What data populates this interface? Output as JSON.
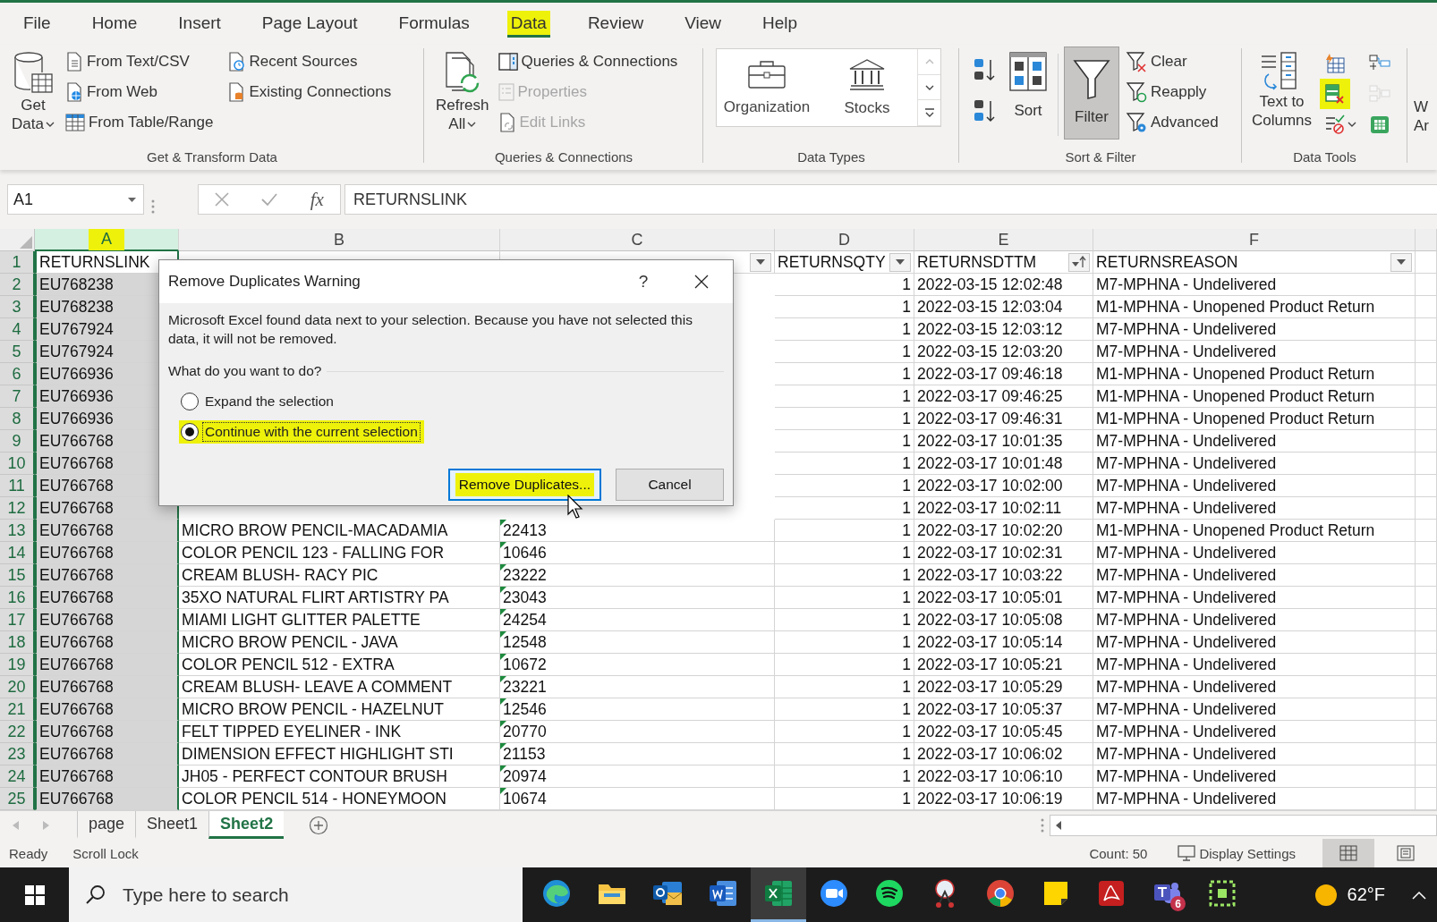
{
  "tabs": [
    {
      "label": "File",
      "selected": false,
      "highlighted": false
    },
    {
      "label": "Home",
      "selected": false,
      "highlighted": false
    },
    {
      "label": "Insert",
      "selected": false,
      "highlighted": false
    },
    {
      "label": "Page Layout",
      "selected": false,
      "highlighted": false
    },
    {
      "label": "Formulas",
      "selected": false,
      "highlighted": false
    },
    {
      "label": "Data",
      "selected": true,
      "highlighted": true
    },
    {
      "label": "Review",
      "selected": false,
      "highlighted": false
    },
    {
      "label": "View",
      "selected": false,
      "highlighted": false
    },
    {
      "label": "Help",
      "selected": false,
      "highlighted": false
    }
  ],
  "ribbon": {
    "get_transform": {
      "title": "Get & Transform Data",
      "get_data": [
        "Get",
        "Data"
      ],
      "items": [
        {
          "label": "From Text/CSV",
          "disabled": false
        },
        {
          "label": "From Web",
          "disabled": false
        },
        {
          "label": "From Table/Range",
          "disabled": false
        },
        {
          "label": "Recent Sources",
          "disabled": false
        },
        {
          "label": "Existing Connections",
          "disabled": false
        }
      ]
    },
    "queries": {
      "title": "Queries & Connections",
      "refresh": [
        "Refresh",
        "All"
      ],
      "items": [
        {
          "label": "Queries & Connections",
          "disabled": false
        },
        {
          "label": "Properties",
          "disabled": true
        },
        {
          "label": "Edit Links",
          "disabled": true
        }
      ]
    },
    "data_types": {
      "title": "Data Types",
      "items": [
        "Organization",
        "Stocks"
      ]
    },
    "sort_filter": {
      "title": "Sort & Filter",
      "sort": "Sort",
      "filter": {
        "label": "Filter",
        "selected": true
      },
      "items": [
        {
          "label": "Clear",
          "disabled": false
        },
        {
          "label": "Reapply",
          "disabled": false
        },
        {
          "label": "Advanced",
          "disabled": false
        }
      ]
    },
    "data_tools": {
      "title": "Data Tools",
      "text_to_columns": [
        "Text to",
        "Columns"
      ],
      "tools": [
        {
          "highlighted": false,
          "disabled": false
        },
        {
          "highlighted": true,
          "disabled": false
        },
        {
          "highlighted": false,
          "disabled": false
        },
        {
          "highlighted": false,
          "disabled": false
        },
        {
          "highlighted": false,
          "disabled": true
        },
        {
          "highlighted": false,
          "disabled": false
        }
      ]
    },
    "what_if": [
      "W",
      "Ar"
    ]
  },
  "formula_bar": {
    "name_box": "A1",
    "fx": "fx",
    "value": "RETURNSLINK"
  },
  "columns": [
    {
      "letter": "A",
      "selected": true,
      "highlighted": true
    },
    {
      "letter": "B",
      "selected": false,
      "highlighted": false
    },
    {
      "letter": "C",
      "selected": false,
      "highlighted": false
    },
    {
      "letter": "D",
      "selected": false,
      "highlighted": false
    },
    {
      "letter": "E",
      "selected": false,
      "highlighted": false
    },
    {
      "letter": "F",
      "selected": false,
      "highlighted": false
    }
  ],
  "header_row": {
    "number": "1",
    "cells": [
      {
        "text": "RETURNSLINK",
        "active": true
      },
      {},
      {
        "filter_button": true
      },
      {
        "text": "RETURNSQTY",
        "filter_button": true
      },
      {
        "text": "RETURNSDTTM",
        "filter_button": true,
        "sorted_ascending": true
      },
      {
        "text": "RETURNSREASON",
        "filter_button": true
      }
    ]
  },
  "rows": [
    {
      "number": "2",
      "link": "EU768238",
      "qty": "1",
      "dttm": "2022-03-15 12:02:48",
      "reason": "M7-MPHNA - Undelivered"
    },
    {
      "number": "3",
      "link": "EU768238",
      "qty": "1",
      "dttm": "2022-03-15 12:03:04",
      "reason": "M1-MPHNA - Unopened Product Return"
    },
    {
      "number": "4",
      "link": "EU767924",
      "qty": "1",
      "dttm": "2022-03-15 12:03:12",
      "reason": "M7-MPHNA - Undelivered"
    },
    {
      "number": "5",
      "link": "EU767924",
      "qty": "1",
      "dttm": "2022-03-15 12:03:20",
      "reason": "M7-MPHNA - Undelivered"
    },
    {
      "number": "6",
      "link": "EU766936",
      "qty": "1",
      "dttm": "2022-03-17 09:46:18",
      "reason": "M1-MPHNA - Unopened Product Return"
    },
    {
      "number": "7",
      "link": "EU766936",
      "qty": "1",
      "dttm": "2022-03-17 09:46:25",
      "reason": "M1-MPHNA - Unopened Product Return"
    },
    {
      "number": "8",
      "link": "EU766936",
      "qty": "1",
      "dttm": "2022-03-17 09:46:31",
      "reason": "M1-MPHNA - Unopened Product Return"
    },
    {
      "number": "9",
      "link": "EU766768",
      "qty": "1",
      "dttm": "2022-03-17 10:01:35",
      "reason": "M7-MPHNA - Undelivered"
    },
    {
      "number": "10",
      "link": "EU766768",
      "qty": "1",
      "dttm": "2022-03-17 10:01:48",
      "reason": "M7-MPHNA - Undelivered"
    },
    {
      "number": "11",
      "link": "EU766768",
      "qty": "1",
      "dttm": "2022-03-17 10:02:00",
      "reason": "M7-MPHNA - Undelivered"
    },
    {
      "number": "12",
      "link": "EU766768",
      "qty": "1",
      "dttm": "2022-03-17 10:02:11",
      "reason": "M7-MPHNA - Undelivered"
    },
    {
      "number": "13",
      "link": "EU766768",
      "sku": "MICRO BROW PENCIL-MACADAMIA",
      "category": "22413",
      "flagged": true,
      "qty": "1",
      "dttm": "2022-03-17 10:02:20",
      "reason": "M1-MPHNA - Unopened Product Return"
    },
    {
      "number": "14",
      "link": "EU766768",
      "sku": "COLOR PENCIL 123 - FALLING FOR",
      "category": "10646",
      "flagged": true,
      "qty": "1",
      "dttm": "2022-03-17 10:02:31",
      "reason": "M7-MPHNA - Undelivered"
    },
    {
      "number": "15",
      "link": "EU766768",
      "sku": "CREAM BLUSH- RACY PIC",
      "category": "23222",
      "flagged": true,
      "qty": "1",
      "dttm": "2022-03-17 10:03:22",
      "reason": "M7-MPHNA - Undelivered"
    },
    {
      "number": "16",
      "link": "EU766768",
      "sku": "35XO NATURAL FLIRT ARTISTRY PA",
      "category": "23043",
      "flagged": true,
      "qty": "1",
      "dttm": "2022-03-17 10:05:01",
      "reason": "M7-MPHNA - Undelivered"
    },
    {
      "number": "17",
      "link": "EU766768",
      "sku": "MIAMI LIGHT GLITTER PALETTE",
      "category": "24254",
      "flagged": true,
      "qty": "1",
      "dttm": "2022-03-17 10:05:08",
      "reason": "M7-MPHNA - Undelivered"
    },
    {
      "number": "18",
      "link": "EU766768",
      "sku": "MICRO BROW PENCIL - JAVA",
      "category": "12548",
      "flagged": true,
      "qty": "1",
      "dttm": "2022-03-17 10:05:14",
      "reason": "M7-MPHNA - Undelivered"
    },
    {
      "number": "19",
      "link": "EU766768",
      "sku": "COLOR PENCIL 512 - EXTRA",
      "category": "10672",
      "flagged": true,
      "qty": "1",
      "dttm": "2022-03-17 10:05:21",
      "reason": "M7-MPHNA - Undelivered"
    },
    {
      "number": "20",
      "link": "EU766768",
      "sku": "CREAM BLUSH- LEAVE A COMMENT",
      "category": "23221",
      "flagged": true,
      "qty": "1",
      "dttm": "2022-03-17 10:05:29",
      "reason": "M7-MPHNA - Undelivered"
    },
    {
      "number": "21",
      "link": "EU766768",
      "sku": "MICRO BROW PENCIL - HAZELNUT",
      "category": "12546",
      "flagged": true,
      "qty": "1",
      "dttm": "2022-03-17 10:05:37",
      "reason": "M7-MPHNA - Undelivered"
    },
    {
      "number": "22",
      "link": "EU766768",
      "sku": "FELT TIPPED EYELINER - INK",
      "category": "20770",
      "flagged": true,
      "qty": "1",
      "dttm": "2022-03-17 10:05:45",
      "reason": "M7-MPHNA - Undelivered"
    },
    {
      "number": "23",
      "link": "EU766768",
      "sku": "DIMENSION EFFECT HIGHLIGHT STI",
      "category": "21153",
      "flagged": true,
      "qty": "1",
      "dttm": "2022-03-17 10:06:02",
      "reason": "M7-MPHNA - Undelivered"
    },
    {
      "number": "24",
      "link": "EU766768",
      "sku": "JH05 - PERFECT CONTOUR BRUSH",
      "category": "20974",
      "flagged": true,
      "qty": "1",
      "dttm": "2022-03-17 10:06:10",
      "reason": "M7-MPHNA - Undelivered"
    },
    {
      "number": "25",
      "link": "EU766768",
      "sku": "COLOR PENCIL 514 - HONEYMOON",
      "category": "10674",
      "flagged": true,
      "qty": "1",
      "dttm": "2022-03-17 10:06:19",
      "reason": "M7-MPHNA - Undelivered"
    }
  ],
  "dialog": {
    "title": "Remove Duplicates Warning",
    "help": "?",
    "message": "Microsoft Excel found data next to your selection. Because you have not selected this data, it will not be removed.",
    "question": "What do you want to do?",
    "options": [
      {
        "label": "Expand the selection",
        "selected": false,
        "highlighted": false
      },
      {
        "label": "Continue with the current selection",
        "selected": true,
        "highlighted": true
      }
    ],
    "buttons": [
      {
        "label": "Remove Duplicates...",
        "default": true,
        "highlighted": true
      },
      {
        "label": "Cancel",
        "default": false,
        "highlighted": false
      }
    ]
  },
  "sheet_tabs": [
    {
      "label": "page",
      "selected": false
    },
    {
      "label": "Sheet1",
      "selected": false
    },
    {
      "label": "Sheet2",
      "selected": true
    }
  ],
  "status_bar": {
    "left": [
      "Ready",
      "Scroll Lock"
    ],
    "count": "Count: 50",
    "display_settings": "Display Settings",
    "views": [
      {
        "selected": true
      },
      {
        "selected": false
      }
    ]
  },
  "taskbar": {
    "search_placeholder": "Type here to search",
    "apps": [
      {
        "active": false
      },
      {
        "active": false
      },
      {
        "active": false
      },
      {
        "active": false
      },
      {
        "active": true
      },
      {
        "active": false
      },
      {
        "active": false
      },
      {
        "active": false
      },
      {
        "active": false
      },
      {
        "active": false
      },
      {
        "active": false
      },
      {
        "active": false,
        "badge": "6"
      },
      {
        "active": false
      }
    ],
    "temperature": "62°F"
  }
}
